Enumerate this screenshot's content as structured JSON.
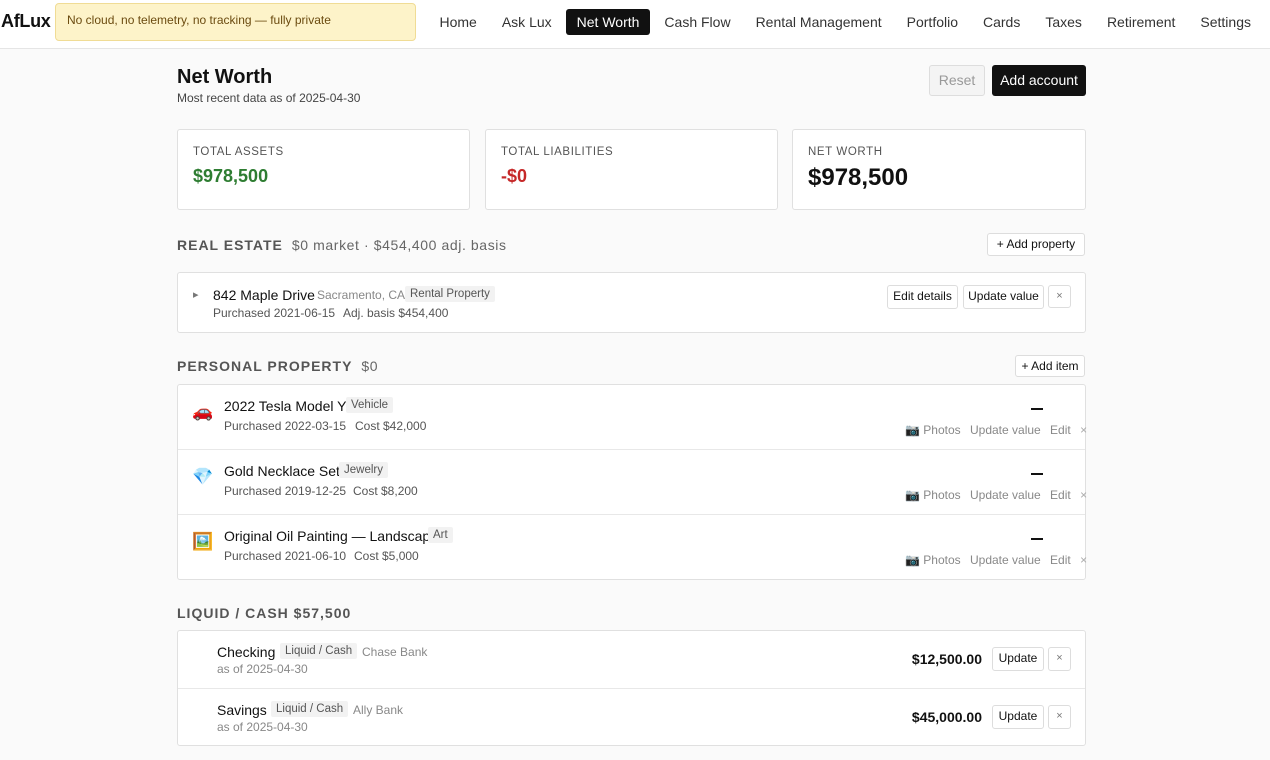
{
  "app": {
    "brand": "AfLux",
    "privacy_notice": "No cloud, no telemetry, no tracking — fully private"
  },
  "nav": {
    "items": [
      "Home",
      "Ask Lux",
      "Net Worth",
      "Cash Flow",
      "Rental Management",
      "Portfolio",
      "Cards",
      "Taxes",
      "Retirement",
      "Settings"
    ],
    "active": "Net Worth"
  },
  "header": {
    "title": "Net Worth",
    "subtitle": "Most recent data as of 2025-04-30",
    "reset_label": "Reset",
    "add_account_label": "Add account"
  },
  "summary": {
    "assets_label": "TOTAL ASSETS",
    "assets_value": "$978,500",
    "assets_color": "#2e7d32",
    "liabilities_label": "TOTAL LIABILITIES",
    "liabilities_value": "-$0",
    "liabilities_color": "#c62828",
    "networth_label": "NET WORTH",
    "networth_value": "$978,500"
  },
  "real_estate": {
    "heading": "REAL ESTATE",
    "summary": "$0 market · $454,400 adj. basis",
    "add_label": "+ Add property",
    "properties": [
      {
        "expander": "▸",
        "name": "842 Maple Drive",
        "location": "Sacramento, CA",
        "type": "Rental Property",
        "purchased": "Purchased 2021-06-15",
        "basis": "Adj. basis $454,400",
        "edit_label": "Edit details",
        "update_label": "Update value",
        "remove_label": "×"
      }
    ]
  },
  "personal_property": {
    "heading": "PERSONAL PROPERTY",
    "total": "$0",
    "add_label": "+ Add item",
    "items": [
      {
        "icon": "car-icon",
        "emoji": "🚗",
        "name": "2022 Tesla Model Y",
        "category": "Vehicle",
        "purchased": "Purchased 2022-03-15",
        "cost": "Cost $42,000",
        "value": "—"
      },
      {
        "icon": "gem-icon",
        "emoji": "💎",
        "name": "Gold Necklace Set",
        "category": "Jewelry",
        "purchased": "Purchased 2019-12-25",
        "cost": "Cost $8,200",
        "value": "—"
      },
      {
        "icon": "painting-icon",
        "emoji": "🖼️",
        "name": "Original Oil Painting — Landscape",
        "category": "Art",
        "purchased": "Purchased 2021-06-10",
        "cost": "Cost $5,000",
        "value": "—"
      }
    ],
    "photos_label": "📷 Photos",
    "update_label": "Update value",
    "edit_label": "Edit",
    "remove_label": "×"
  },
  "liquid": {
    "heading": "LIQUID / CASH $57,500",
    "accounts": [
      {
        "name": "Checking",
        "type": "Liquid / Cash",
        "institution": "Chase Bank",
        "asof": "as of 2025-04-30",
        "amount": "$12,500.00"
      },
      {
        "name": "Savings",
        "type": "Liquid / Cash",
        "institution": "Ally Bank",
        "asof": "as of 2025-04-30",
        "amount": "$45,000.00"
      }
    ],
    "update_label": "Update",
    "remove_label": "×"
  }
}
